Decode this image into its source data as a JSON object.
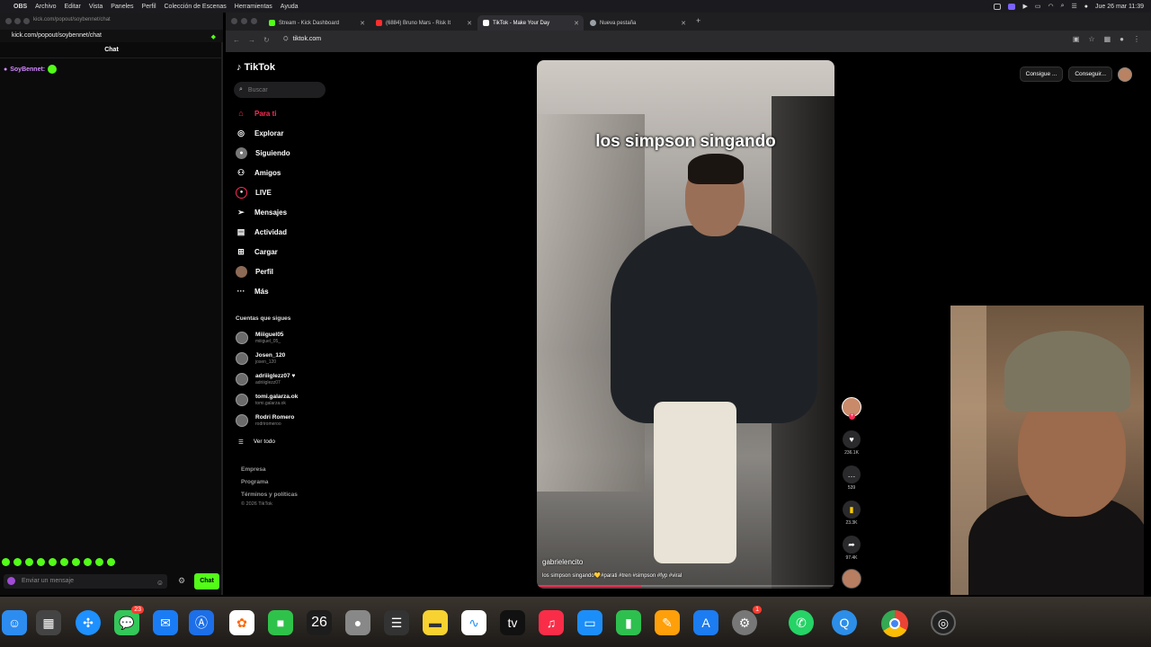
{
  "menubar": {
    "app": "OBS",
    "items": [
      "Archivo",
      "Editar",
      "Vista",
      "Paneles",
      "Perfil",
      "Colección de Escenas",
      "Herramientas",
      "Ayuda"
    ],
    "datetime": "Jue 26 mar  11:39"
  },
  "chat_window": {
    "title_url": "kick.com/popout/soybennet/chat",
    "url": "kick.com/popout/soybennet/chat",
    "header": "Chat",
    "message_user": "SoyBennet:",
    "input_placeholder": "Enviar un mensaje",
    "send_label": "Chat"
  },
  "browser": {
    "tabs": [
      {
        "label": "Stream - Kick Dashboard",
        "color": "#53fc18",
        "active": false
      },
      {
        "label": "(6884) Bruno Mars - Risk It",
        "color": "#ff2d2d",
        "active": false
      },
      {
        "label": "TikTok - Make Your Day",
        "color": "#ffffff",
        "active": true
      },
      {
        "label": "Nueva pestaña",
        "color": "#9aa0a6",
        "active": false
      }
    ],
    "url": "tiktok.com"
  },
  "tiktok": {
    "logo": "TikTok",
    "search_placeholder": "Buscar",
    "nav": [
      {
        "label": "Para ti",
        "icon": "home-icon",
        "active": true
      },
      {
        "label": "Explorar",
        "icon": "compass-icon",
        "active": false
      },
      {
        "label": "Siguiendo",
        "icon": "following-icon",
        "active": false
      },
      {
        "label": "Amigos",
        "icon": "friends-icon",
        "active": false
      },
      {
        "label": "LIVE",
        "icon": "live-icon",
        "active": false
      },
      {
        "label": "Mensajes",
        "icon": "messages-icon",
        "active": false
      },
      {
        "label": "Actividad",
        "icon": "activity-icon",
        "active": false
      },
      {
        "label": "Cargar",
        "icon": "upload-icon",
        "active": false
      },
      {
        "label": "Perfil",
        "icon": "profile-icon",
        "active": false
      },
      {
        "label": "Más",
        "icon": "more-icon",
        "active": false
      }
    ],
    "following_heading": "Cuentas que sigues",
    "following": [
      {
        "name": "Miiiguel05",
        "handle": "miiiguel_05_"
      },
      {
        "name": "Josen_120",
        "handle": "josen_120"
      },
      {
        "name": "adriiiglezz07 ♥",
        "handle": "adriiiglezz07"
      },
      {
        "name": "tomi.galarza.ok",
        "handle": "tomi.galarza.ok"
      },
      {
        "name": "Rodri Romero",
        "handle": "rodriromeroo"
      }
    ],
    "see_all": "Ver todo",
    "footer_links": [
      "Empresa",
      "Programa",
      "Términos y políticas"
    ],
    "copyright": "© 2026 TikTok",
    "top_buttons": [
      "Consigue ...",
      "Conseguir..."
    ],
    "video": {
      "caption": "los simpson singando",
      "username": "gabrielencito",
      "description": "los simpson singando💛#parati #tren #simpson #fyp #viral",
      "progress": 0.35
    },
    "actions": {
      "likes": "236.1K",
      "comments": "539",
      "saves": "23.3K",
      "shares": "97.4K"
    }
  },
  "dock": {
    "messages_badge": "23",
    "calendar_day": "26",
    "settings_badge": "1",
    "icons": [
      "finder-icon",
      "launchpad-icon",
      "safari-icon",
      "messages-icon",
      "mail-icon",
      "appstore-icon",
      "photos-icon",
      "facetime-icon",
      "calendar-icon",
      "contacts-icon",
      "reminders-icon",
      "notes-icon",
      "freeform-icon",
      "appletv-icon",
      "music-icon",
      "keynote-icon",
      "numbers-icon",
      "pages-icon",
      "xcode-icon",
      "settings-icon",
      "whatsapp-icon",
      "qbittorrent-icon",
      "chrome-icon",
      "obs-icon"
    ]
  }
}
